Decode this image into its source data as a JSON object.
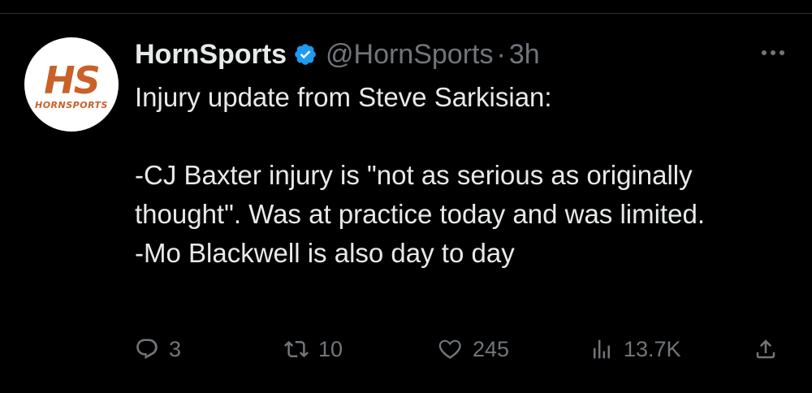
{
  "author": {
    "display_name": "HornSports",
    "handle": "@HornSports",
    "separator": "·",
    "time": "3h",
    "verified": true,
    "avatar": {
      "monogram": "HS",
      "word": "HORNSPORTS",
      "brand_color": "#c9612a"
    }
  },
  "tweet": {
    "lines": [
      "Injury update from Steve Sarkisian:",
      "",
      "-CJ Baxter injury is \"not as serious as originally thought\". Was at practice today and was limited.",
      "-Mo Blackwell is also day to day"
    ]
  },
  "actions": {
    "reply": {
      "icon": "reply-icon",
      "count": "3"
    },
    "retweet": {
      "icon": "retweet-icon",
      "count": "10"
    },
    "like": {
      "icon": "heart-icon",
      "count": "245"
    },
    "views": {
      "icon": "views-icon",
      "count": "13.7K"
    },
    "share": {
      "icon": "share-icon"
    }
  },
  "colors": {
    "background": "#000000",
    "text": "#e7e9ea",
    "muted": "#71767b",
    "verified": "#1d9bf0"
  }
}
